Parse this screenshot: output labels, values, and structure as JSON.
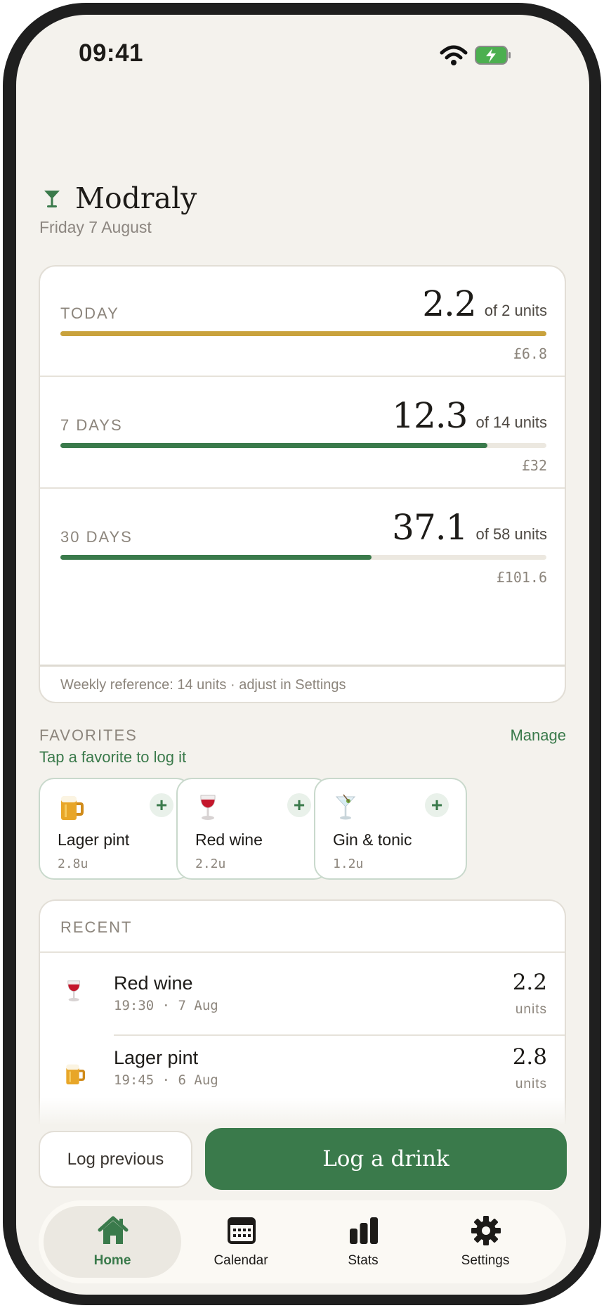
{
  "status": {
    "time": "09:41"
  },
  "app": {
    "name": "Modraly",
    "date": "Friday 7 August"
  },
  "summary": {
    "rows": [
      {
        "label": "TODAY",
        "value": "2.2",
        "of": "of 2 units",
        "cost": "£6.8",
        "progress": 1.0,
        "color": "#c9a23c"
      },
      {
        "label": "7 DAYS",
        "value": "12.3",
        "of": "of 14 units",
        "cost": "£32",
        "progress": 0.879,
        "color": "#3a7a4b"
      },
      {
        "label": "30 DAYS",
        "value": "37.1",
        "of": "of 58 units",
        "cost": "£101.6",
        "progress": 0.64,
        "color": "#3a7a4b"
      }
    ],
    "footer": "Weekly reference: 14 units · adjust in Settings"
  },
  "favorites": {
    "heading": "FAVORITES",
    "manage": "Manage",
    "hint": "Tap a favorite to log it",
    "items": [
      {
        "name": "Lager pint",
        "units": "2.8u",
        "icon": "beer-mug-icon"
      },
      {
        "name": "Red wine",
        "units": "2.2u",
        "icon": "wine-glass-icon"
      },
      {
        "name": "Gin & tonic",
        "units": "1.2u",
        "icon": "cocktail-glass-icon"
      }
    ],
    "plus": "+"
  },
  "recent": {
    "heading": "RECENT",
    "items": [
      {
        "name": "Red wine",
        "meta": "19:30 · 7 Aug",
        "value": "2.2",
        "unit": "units",
        "icon": "wine-glass-icon"
      },
      {
        "name": "Lager pint",
        "meta": "19:45 · 6 Aug",
        "value": "2.8",
        "unit": "units",
        "icon": "beer-mug-icon"
      }
    ]
  },
  "actions": {
    "log_previous": "Log previous",
    "log_drink": "Log a drink"
  },
  "tabs": [
    {
      "label": "Home",
      "icon": "home-icon",
      "active": true
    },
    {
      "label": "Calendar",
      "icon": "calendar-icon",
      "active": false
    },
    {
      "label": "Stats",
      "icon": "stats-icon",
      "active": false
    },
    {
      "label": "Settings",
      "icon": "gear-icon",
      "active": false
    }
  ],
  "colors": {
    "accent": "#3a7a4b",
    "today_bar": "#c9a23c",
    "background": "#f4f2ed"
  }
}
